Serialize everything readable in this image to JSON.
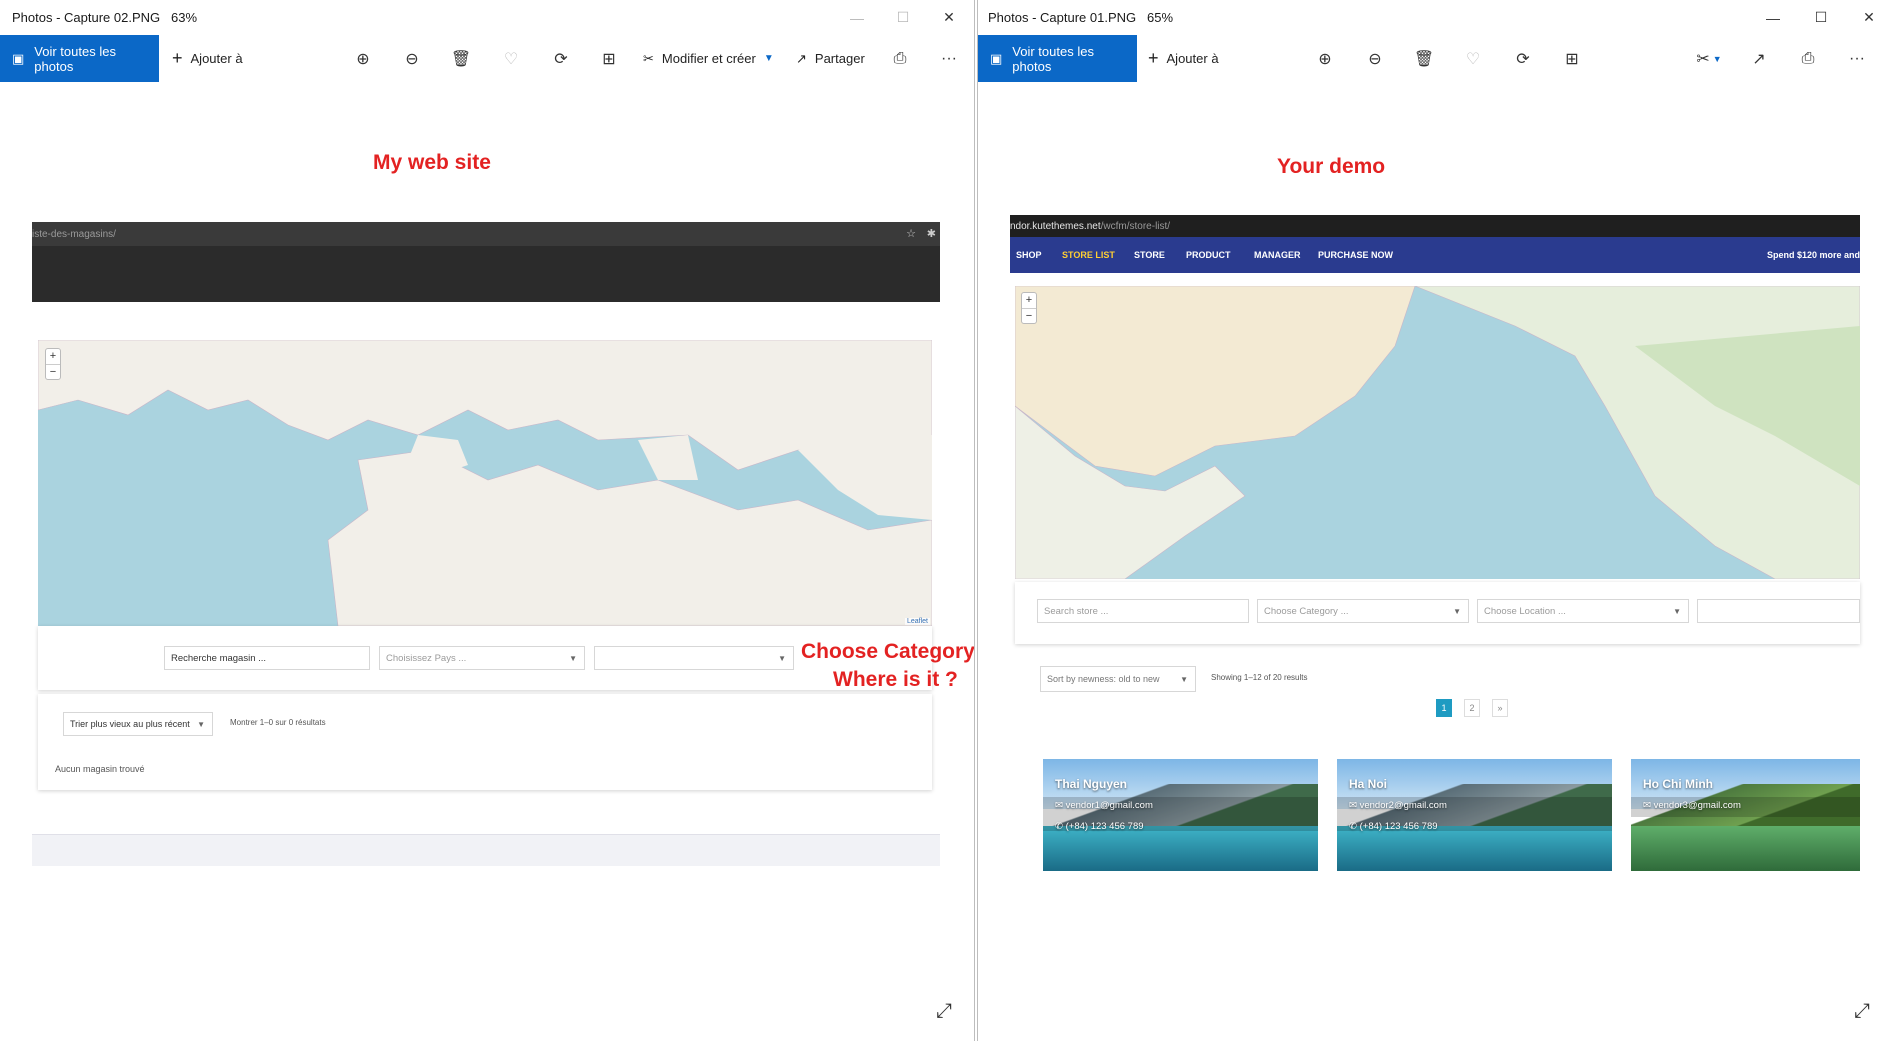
{
  "left_window": {
    "title": "Photos - Capture 02.PNG",
    "zoom": "63%",
    "toolbar": {
      "view_all": "Voir toutes les photos",
      "add_to": "Ajouter à",
      "edit_create": "Modifier et créer",
      "share": "Partager",
      "more": "···"
    },
    "annotation_title": "My web site",
    "annotation_note_1": "Choose Category",
    "annotation_note_2": "Where is it   ?",
    "screenshot": {
      "url": "iste-des-magasins/",
      "map_attribution": "Leaflet",
      "search_placeholder": "Recherche magasin ...",
      "country_placeholder": "Choisissez Pays ...",
      "sort_label": "Trier plus vieux au plus récent",
      "results_text": "Montrer 1–0 sur 0 résultats",
      "empty_text": "Aucun magasin trouvé"
    }
  },
  "right_window": {
    "title": "Photos - Capture 01.PNG",
    "zoom": "65%",
    "toolbar": {
      "view_all": "Voir toutes les photos",
      "add_to": "Ajouter à",
      "more": "···"
    },
    "annotation_title": "Your demo",
    "screenshot": {
      "url_host": "ndor.kutethemes.net",
      "url_path": "/wcfm/store-list/",
      "nav": [
        "SHOP",
        "STORE LIST",
        "STORE",
        "PRODUCT",
        "MANAGER",
        "PURCHASE NOW"
      ],
      "promo": "Spend $120 more and",
      "search_placeholder": "Search store ...",
      "category_placeholder": "Choose Category ...",
      "location_placeholder": "Choose Location ...",
      "sort_label": "Sort by newness: old to new",
      "results_text": "Showing 1–12 of 20 results",
      "pages": [
        "1",
        "2",
        "»"
      ],
      "stores": [
        {
          "name": "Thai Nguyen",
          "email": "vendor1@gmail.com",
          "phone": "(+84) 123 456 789"
        },
        {
          "name": "Ha Noi",
          "email": "vendor2@gmail.com",
          "phone": "(+84) 123 456 789"
        },
        {
          "name": "Ho Chi Minh",
          "email": "vendor3@gmail.com",
          "phone": ""
        }
      ]
    }
  },
  "colors": {
    "accent": "#0b68c7",
    "annotation": "#e32222",
    "nav": "#2a3b8f",
    "nav_active": "#ffcf33",
    "page_active": "#1e9bc2"
  }
}
